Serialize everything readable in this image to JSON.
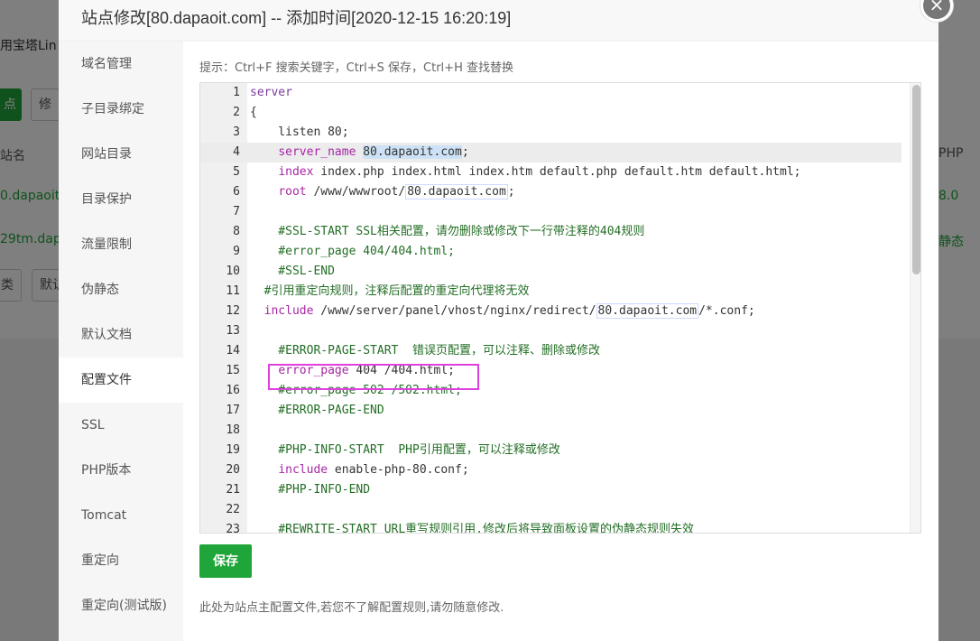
{
  "background": {
    "title_fragment": "用宝塔Lin",
    "add_button_fragment": "点",
    "edit_button_fragment": "修",
    "col_site_fragment": "站名",
    "col_php": "PHP",
    "row1_site": "0.dapaoit.",
    "row1_php": "8.0",
    "row2_site": "29tm.dapa",
    "row2_php": "静态",
    "btn_class_fragment": "类",
    "btn_default_fragment": "默认"
  },
  "modal": {
    "title": "站点修改[80.dapaoit.com] -- 添加时间[2020-12-15 16:20:19]",
    "close_label": "×",
    "sidebar": [
      {
        "label": "域名管理"
      },
      {
        "label": "子目录绑定"
      },
      {
        "label": "网站目录"
      },
      {
        "label": "目录保护"
      },
      {
        "label": "流量限制"
      },
      {
        "label": "伪静态"
      },
      {
        "label": "默认文档"
      },
      {
        "label": "配置文件"
      },
      {
        "label": "SSL"
      },
      {
        "label": "PHP版本"
      },
      {
        "label": "Tomcat"
      },
      {
        "label": "重定向"
      },
      {
        "label": "重定向(测试版)"
      }
    ],
    "active_tab": "配置文件",
    "tip": "提示：Ctrl+F 搜索关键字，Ctrl+S 保存，Ctrl+H 查找替换",
    "save_label": "保存",
    "footnote": "此处为站点主配置文件,若您不了解配置规则,请勿随意修改.",
    "editor": {
      "active_line": 4,
      "highlighted_line": 15,
      "lines": [
        {
          "n": "1",
          "parts": [
            {
              "t": "server",
              "c": "kw"
            }
          ]
        },
        {
          "n": "2",
          "parts": [
            {
              "t": "{",
              "c": ""
            }
          ]
        },
        {
          "n": "3",
          "parts": [
            {
              "t": "    listen 80;",
              "c": ""
            }
          ]
        },
        {
          "n": "4",
          "parts": [
            {
              "t": "    ",
              "c": ""
            },
            {
              "t": "server_name",
              "c": "dir"
            },
            {
              "t": " ",
              "c": ""
            },
            {
              "t": "80.dapaoit.com",
              "c": "sel"
            },
            {
              "t": ";",
              "c": ""
            }
          ]
        },
        {
          "n": "5",
          "parts": [
            {
              "t": "    ",
              "c": ""
            },
            {
              "t": "index",
              "c": "dir"
            },
            {
              "t": " index.php index.html index.htm default.php default.htm default.html;",
              "c": ""
            }
          ]
        },
        {
          "n": "6",
          "parts": [
            {
              "t": "    ",
              "c": ""
            },
            {
              "t": "root",
              "c": "dir"
            },
            {
              "t": " /www/wwwroot/",
              "c": ""
            },
            {
              "t": "80.dapaoit.com",
              "c": "boxed"
            },
            {
              "t": ";",
              "c": ""
            }
          ]
        },
        {
          "n": "7",
          "parts": [
            {
              "t": "",
              "c": ""
            }
          ]
        },
        {
          "n": "8",
          "parts": [
            {
              "t": "    #SSL-START SSL相关配置，请勿删除或修改下一行带注释的404规则",
              "c": "cm"
            }
          ]
        },
        {
          "n": "9",
          "parts": [
            {
              "t": "    #error_page 404/404.html;",
              "c": "cm"
            }
          ]
        },
        {
          "n": "10",
          "parts": [
            {
              "t": "    #SSL-END",
              "c": "cm"
            }
          ]
        },
        {
          "n": "11",
          "parts": [
            {
              "t": "  #引用重定向规则，注释后配置的重定向代理将无效",
              "c": "cm"
            }
          ]
        },
        {
          "n": "12",
          "parts": [
            {
              "t": "  ",
              "c": ""
            },
            {
              "t": "include",
              "c": "dir"
            },
            {
              "t": " /www/server/panel/vhost/nginx/redirect/",
              "c": ""
            },
            {
              "t": "80.dapaoit.com",
              "c": "boxed"
            },
            {
              "t": "/*.conf;",
              "c": ""
            }
          ]
        },
        {
          "n": "13",
          "parts": [
            {
              "t": "",
              "c": ""
            }
          ]
        },
        {
          "n": "14",
          "parts": [
            {
              "t": "    #ERROR-PAGE-START  错误页配置，可以注释、删除或修改",
              "c": "cm"
            }
          ]
        },
        {
          "n": "15",
          "parts": [
            {
              "t": "    ",
              "c": ""
            },
            {
              "t": "error_page",
              "c": "dir"
            },
            {
              "t": " 404 /404.html;",
              "c": ""
            }
          ]
        },
        {
          "n": "16",
          "parts": [
            {
              "t": "    #error_page 502 /502.html;",
              "c": "cm"
            }
          ]
        },
        {
          "n": "17",
          "parts": [
            {
              "t": "    #ERROR-PAGE-END",
              "c": "cm"
            }
          ]
        },
        {
          "n": "18",
          "parts": [
            {
              "t": "",
              "c": ""
            }
          ]
        },
        {
          "n": "19",
          "parts": [
            {
              "t": "    #PHP-INFO-START  PHP引用配置，可以注释或修改",
              "c": "cm"
            }
          ]
        },
        {
          "n": "20",
          "parts": [
            {
              "t": "    ",
              "c": ""
            },
            {
              "t": "include",
              "c": "dir"
            },
            {
              "t": " enable-php-80.conf;",
              "c": ""
            }
          ]
        },
        {
          "n": "21",
          "parts": [
            {
              "t": "    #PHP-INFO-END",
              "c": "cm"
            }
          ]
        },
        {
          "n": "22",
          "parts": [
            {
              "t": "",
              "c": ""
            }
          ]
        },
        {
          "n": "23",
          "parts": [
            {
              "t": "    #REWRITE-START URL重写规则引用,修改后将导致面板设置的伪静态规则失效",
              "c": "cm"
            }
          ]
        }
      ]
    }
  },
  "colors": {
    "accent": "#20a53a",
    "highlight_box": "#e040e0",
    "keyword": "#7a3e9d",
    "comment": "#236e25"
  }
}
